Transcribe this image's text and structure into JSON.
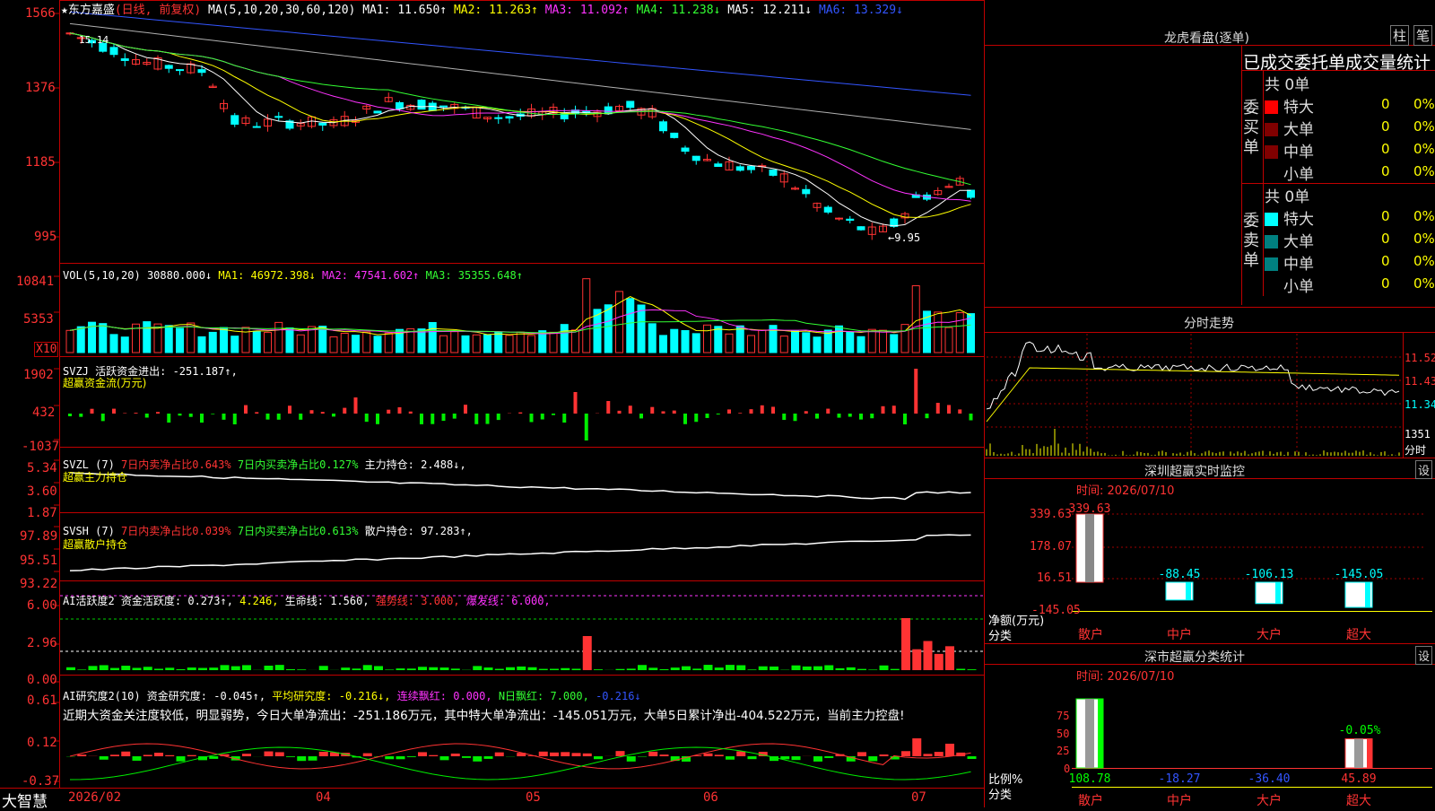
{
  "colors": {
    "up": "#ff3333",
    "down": "#00ffff",
    "border": "#c00000",
    "ma1": "#ffffff",
    "ma2": "#ffff00",
    "ma3": "#ff33ff",
    "ma4": "#33ff33",
    "ma5": "#b0b0b0",
    "ma6": "#3355ff",
    "bg": "#000000"
  },
  "header": {
    "star": "★",
    "stock_name": "东方嘉盛",
    "period": "(日线, 前复权)",
    "ma_title": "MA(5,10,20,30,60,120)",
    "ma1": "MA1: 11.650↑",
    "ma2": "MA2: 11.263↑",
    "ma3": "MA3: 11.092↑",
    "ma4": "MA4: 11.238↓",
    "ma5": "MA5: 12.211↓",
    "ma6": "MA6: 13.329↓"
  },
  "price_axis": [
    "1566",
    "1376",
    "1185",
    "995"
  ],
  "price_annotations": {
    "high": "15.14",
    "low": "←9.95"
  },
  "vol": {
    "title": "VOL(5,10,20)",
    "value": "30880.000↓",
    "ma1": "MA1: 46972.398↓",
    "ma2": "MA2: 47541.602↑",
    "ma3": "MA3: 35355.648↑",
    "axis": [
      "10841",
      "5353"
    ],
    "unit": "X10"
  },
  "svzj": {
    "title": "SVZJ  活跃资金进出: -251.187↑,",
    "subtitle": "超赢资金流(万元)",
    "axis": [
      "1902",
      "432",
      "-1037"
    ]
  },
  "svzl": {
    "title": "SVZL (7)",
    "t1": "7日内卖净占比0.643%",
    "t2": "7日内买卖净占比0.127%",
    "t3": "主力持仓: 2.488↓,",
    "subtitle": "超赢主力持仓",
    "axis": [
      "5.34",
      "3.60",
      "1.87"
    ]
  },
  "svsh": {
    "title": "SVSH (7)",
    "t1": "7日内卖净占比0.039%",
    "t2": "7日内买卖净占比0.613%",
    "t3": "散户持仓: 97.283↑,",
    "subtitle": "超赢散户持仓",
    "axis": [
      "97.89",
      "95.51",
      "93.22"
    ]
  },
  "ai1": {
    "title": "AI活跃度2 资金活跃度: 0.273↑,",
    "v2": "4.246,",
    "v3": "生命线: 1.560,",
    "v4": "强势线: 3.000,",
    "v5": "爆发线: 6.000,",
    "axis": [
      "6.00",
      "2.96",
      "0.00"
    ]
  },
  "ai2": {
    "title": "AI研究度2(10) 资金研究度: -0.045↑,",
    "v2": "平均研究度: -0.216↓,",
    "v3": "连续飘红: 0.000,",
    "v4": "N日飘红: 7.000,",
    "v5": "-0.216↓",
    "comment": "近期大资金关注度较低，明显弱势，今日大单净流出：-251.186万元，其中特大单净流出：-145.051万元，大单5日累计净出-404.522万元，当前主力控盘!",
    "axis": [
      "0.61",
      "0.12",
      "-0.37"
    ]
  },
  "bottom": {
    "brand": "大智慧",
    "dates": [
      "2026/02",
      "04",
      "05",
      "06",
      "07"
    ]
  },
  "right": {
    "title": "龙虎看盘(逐单)",
    "btn_zhu": "柱",
    "btn_bi": "笔",
    "stats_title": "已成交委托单成交量统计",
    "buy_label": "委买单",
    "sell_label": "委卖单",
    "buy_total": "共 0单",
    "sell_total": "共 0单",
    "levels": [
      "特大",
      "大单",
      "中单",
      "小单"
    ],
    "buy_colors": [
      "#ff0000",
      "#800000",
      "#800000",
      "#000000"
    ],
    "sell_colors": [
      "#00ffff",
      "#008080",
      "#008080",
      "#000000"
    ],
    "buy_counts": [
      "0",
      "0",
      "0",
      "0"
    ],
    "buy_pcts": [
      "0%",
      "0%",
      "0%",
      "0%"
    ],
    "sell_counts": [
      "0",
      "0",
      "0",
      "0"
    ],
    "sell_pcts": [
      "0%",
      "0%",
      "0%",
      "0%"
    ],
    "intraday_title": "分时走势",
    "intraday_axis": [
      "11.52",
      "11.43",
      "11.34"
    ],
    "intraday_vol": "1351",
    "intraday_unit": "分时",
    "monitor_title": "深圳超赢实时监控",
    "monitor_btn": "设",
    "monitor_time": "时间: 2026/07/10",
    "monitor_axis": [
      "339.63",
      "178.07",
      "16.51",
      "-145.05"
    ],
    "monitor_ylabel": "净额(万元)",
    "monitor_xlabel": "分类",
    "categories": [
      "散户",
      "中户",
      "大户",
      "超大"
    ],
    "class_title": "深市超赢分类统计",
    "class_btn": "设",
    "class_time": "时间: 2026/07/10",
    "class_axis": [
      "75",
      "50",
      "25",
      "0"
    ],
    "class_ylabel": "比例%",
    "class_xlabel": "分类"
  },
  "chart_data": [
    {
      "type": "bar",
      "title": "深圳超赢实时监控",
      "xlabel": "分类",
      "ylabel": "净额(万元)",
      "categories": [
        "散户",
        "中户",
        "大户",
        "超大"
      ],
      "values": [
        339.63,
        -88.45,
        -106.13,
        -145.05
      ],
      "ylim": [
        -145.05,
        339.63
      ]
    },
    {
      "type": "bar",
      "title": "深市超赢分类统计",
      "xlabel": "分类",
      "ylabel": "比例%",
      "categories": [
        "散户",
        "中户",
        "大户",
        "超大"
      ],
      "values": [
        108.78,
        -18.27,
        -36.4,
        45.89
      ],
      "annotations": [
        "-0.05%"
      ],
      "ylim": [
        0,
        75
      ]
    }
  ]
}
